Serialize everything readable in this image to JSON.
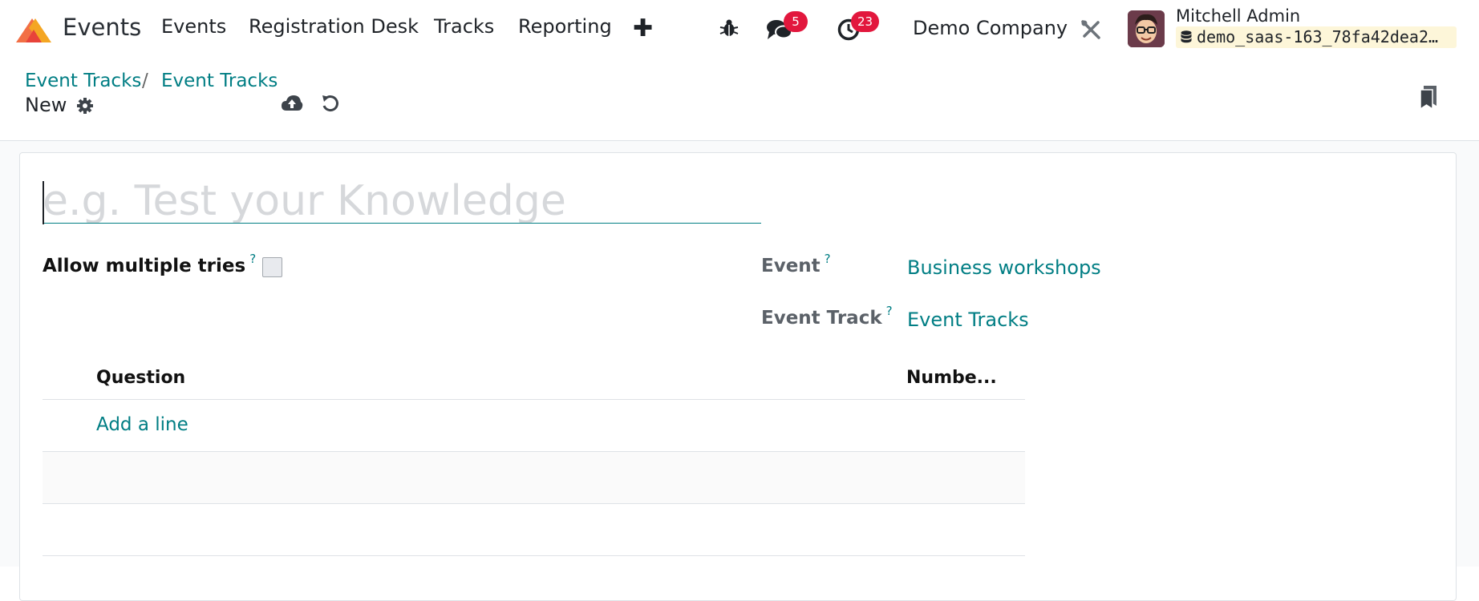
{
  "navbar": {
    "app_name": "Events",
    "menu": [
      "Events",
      "Registration Desk",
      "Tracks",
      "Reporting"
    ],
    "new_label": "✚",
    "messages_count": "5",
    "activities_count": "23",
    "company": "Demo Company",
    "user": {
      "name": "Mitchell Admin",
      "database": "demo_saas-163_78fa42dea2…"
    },
    "icons": [
      "odoo-logo-icon",
      "bug-icon",
      "chat-icon",
      "clock-icon",
      "tools-icon",
      "database-icon"
    ],
    "badge_color": "#e2173d"
  },
  "control_panel": {
    "breadcrumbs": [
      "Event Tracks",
      "Event Tracks"
    ],
    "separator": "/",
    "record_name": "New",
    "icons": [
      "gear-icon",
      "cloud-upload-icon",
      "discard-icon",
      "bookmark-icon"
    ]
  },
  "form": {
    "title_placeholder": "e.g. Test your Knowledge",
    "title_value": "",
    "allow_multiple_tries": {
      "label": "Allow multiple tries",
      "help": "?",
      "checked": false
    },
    "event": {
      "label": "Event",
      "help": "?",
      "value": "Business workshops"
    },
    "event_track": {
      "label": "Event Track",
      "help": "?",
      "value": "Event Tracks"
    },
    "questions": {
      "columns": [
        "Question",
        "Numbe..."
      ],
      "add_line": "Add a line",
      "rows": []
    },
    "accent_color": "#017e84"
  }
}
